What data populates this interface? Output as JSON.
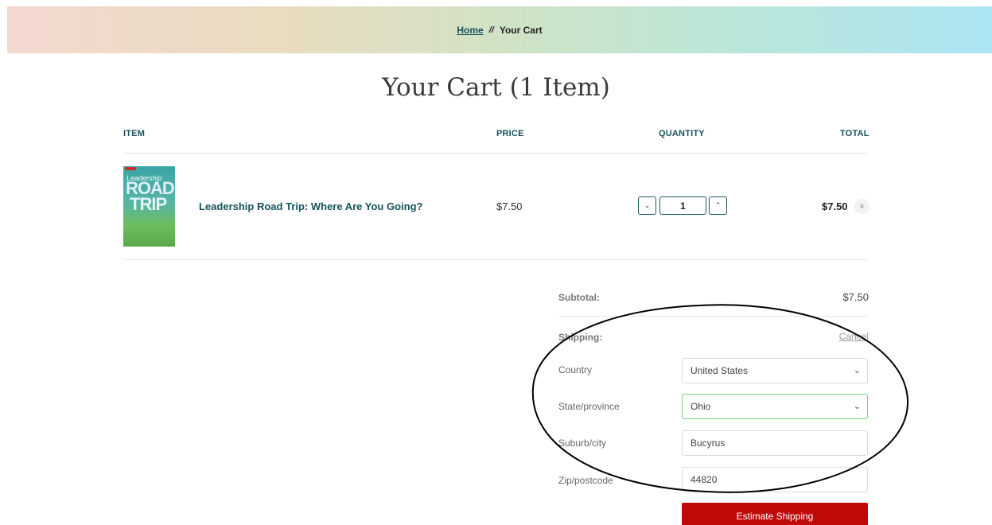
{
  "breadcrumb": {
    "home": "Home",
    "separator": "//",
    "current": "Your Cart"
  },
  "page": {
    "title": "Your Cart (1 Item)"
  },
  "table": {
    "headers": {
      "item": "ITEM",
      "price": "PRICE",
      "quantity": "QUANTITY",
      "total": "TOTAL"
    }
  },
  "cart_item": {
    "name": "Leadership Road Trip: Where Are You Going?",
    "price": "$7.50",
    "quantity": "1",
    "total": "$7.50",
    "thumbnail": {
      "line1": "Leadership",
      "line2": "ROAD",
      "line3": "TRIP"
    },
    "decrease_icon": "chevron-down-icon",
    "increase_icon": "chevron-up-icon",
    "remove_icon": "close-icon"
  },
  "summary": {
    "subtotal_label": "Subtotal:",
    "subtotal_value": "$7.50",
    "shipping_label": "Shipping:",
    "cancel_label": "Cancel",
    "country_label": "Country",
    "country_value": "United States",
    "state_label": "State/province",
    "state_value": "Ohio",
    "city_label": "Suburb/city",
    "city_value": "Bucyrus",
    "zip_label": "Zip/postcode",
    "zip_value": "44820",
    "estimate_button": "Estimate Shipping"
  },
  "colors": {
    "accent_teal": "#14535a",
    "button_red": "#c00a0a",
    "active_border": "#7bd07b"
  }
}
